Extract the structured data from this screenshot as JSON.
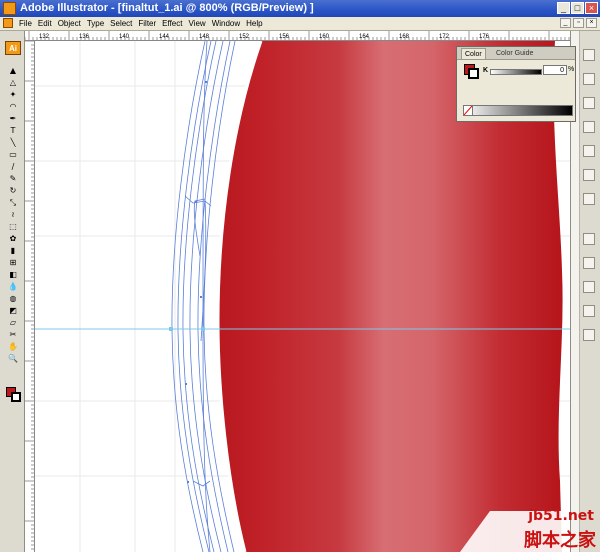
{
  "window": {
    "title": "Adobe Illustrator - [finaltut_1.ai @ 800% (RGB/Preview) ]",
    "minimize": "_",
    "maximize": "□",
    "close": "×"
  },
  "menubar": {
    "items": [
      "File",
      "Edit",
      "Object",
      "Type",
      "Select",
      "Filter",
      "Effect",
      "View",
      "Window",
      "Help"
    ]
  },
  "tools": {
    "logo": "Ai",
    "icons": [
      "selection-tool",
      "direct-selection-tool",
      "magic-wand-tool",
      "lasso-tool",
      "pen-tool",
      "type-tool",
      "line-tool",
      "rectangle-tool",
      "paintbrush-tool",
      "pencil-tool",
      "rotate-tool",
      "scale-tool",
      "warp-tool",
      "free-transform-tool",
      "symbol-sprayer-tool",
      "column-graph-tool",
      "mesh-tool",
      "gradient-tool",
      "eyedropper-tool",
      "blend-tool",
      "live-paint-tool",
      "slice-tool",
      "scissors-tool",
      "hand-tool",
      "zoom-tool"
    ],
    "colors": {
      "fill": "#c0171b",
      "stroke": "#ffffff"
    }
  },
  "ruler": {
    "top_labels": [
      "132",
      "136",
      "140",
      "144",
      "148",
      "152",
      "156",
      "160",
      "164",
      "168",
      "172",
      "176"
    ]
  },
  "color_panel": {
    "tabs": [
      "Color",
      "Color Guide"
    ],
    "channel": "K",
    "value": "0",
    "unit": "%"
  },
  "canvas": {
    "colors": {
      "shape_dark": "#b8181e",
      "shape_mid": "#c63a40",
      "shape_light": "#d76e73",
      "guide": "#7ec8ec",
      "paths": "#5a7fd8"
    }
  },
  "dock": {
    "icons": [
      "color-panel-icon",
      "color-guide-icon",
      "swatches-icon",
      "brushes-icon",
      "symbols-icon",
      "stroke-icon",
      "gradient-icon",
      "transparency-icon",
      "appearance-icon",
      "graphic-styles-icon",
      "layers-icon",
      "links-icon"
    ]
  },
  "watermark": {
    "top": "jb51.net",
    "bottom": "脚本之家"
  }
}
